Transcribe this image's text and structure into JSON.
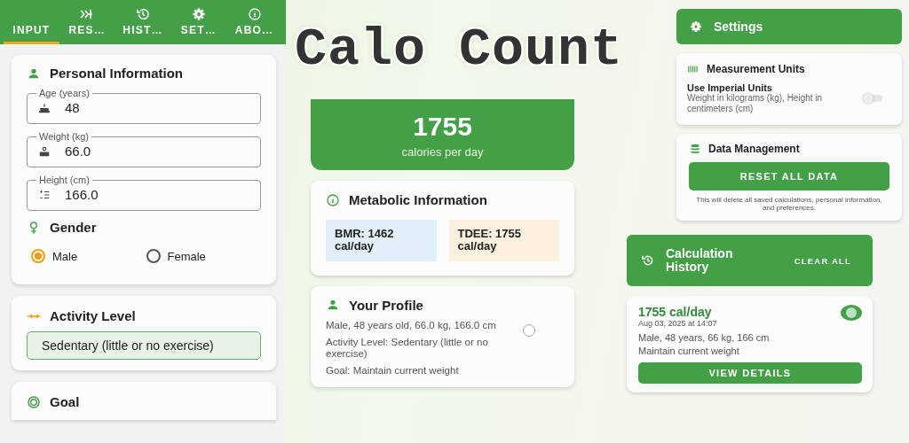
{
  "app_title": "Calo Count",
  "input_screen": {
    "tabs": [
      {
        "label": "INPUT",
        "selected": true
      },
      {
        "label": "RES…",
        "selected": false
      },
      {
        "label": "HIST…",
        "selected": false
      },
      {
        "label": "SET…",
        "selected": false
      },
      {
        "label": "ABO…",
        "selected": false
      }
    ],
    "personal": {
      "title": "Personal Information",
      "fields": [
        {
          "label": "Age (years)",
          "value": "48"
        },
        {
          "label": "Weight (kg)",
          "value": "66.0"
        },
        {
          "label": "Height (cm)",
          "value": "166.0"
        }
      ]
    },
    "gender": {
      "title": "Gender",
      "options": [
        {
          "label": "Male",
          "selected": true
        },
        {
          "label": "Female",
          "selected": false
        }
      ]
    },
    "activity": {
      "title": "Activity Level",
      "value": "Sedentary (little or no exercise)"
    },
    "goal": {
      "title": "Goal"
    }
  },
  "results_screen": {
    "calories": "1755",
    "calories_unit": "calories per day",
    "metabolic": {
      "title": "Metabolic Information",
      "bmr": "BMR: 1462 cal/day",
      "tdee": "TDEE: 1755 cal/day"
    },
    "profile": {
      "title": "Your Profile",
      "lines": [
        "Male, 48 years old, 66.0 kg, 166.0 cm",
        "Activity Level: Sedentary (little or no exercise)",
        "Goal: Maintain current weight"
      ]
    }
  },
  "settings_screen": {
    "title": "Settings",
    "units": {
      "title": "Measurement Units",
      "option": "Use Imperial Units",
      "description": "Weight in kilograms (kg), Height in centimeters (cm)",
      "on": false
    },
    "data": {
      "title": "Data Management",
      "button": "RESET ALL DATA",
      "note": "This will delete all saved calculations, personal information, and preferences."
    }
  },
  "history_screen": {
    "title": "Calculation History",
    "clear_button": "CLEAR ALL",
    "entries": [
      {
        "calories": "1755 cal/day",
        "date": "Aug 03, 2025 at 14:07",
        "details": "Male, 48 years, 66 kg, 166 cm",
        "goal": "Maintain current weight",
        "button": "VIEW DETAILS"
      }
    ]
  }
}
